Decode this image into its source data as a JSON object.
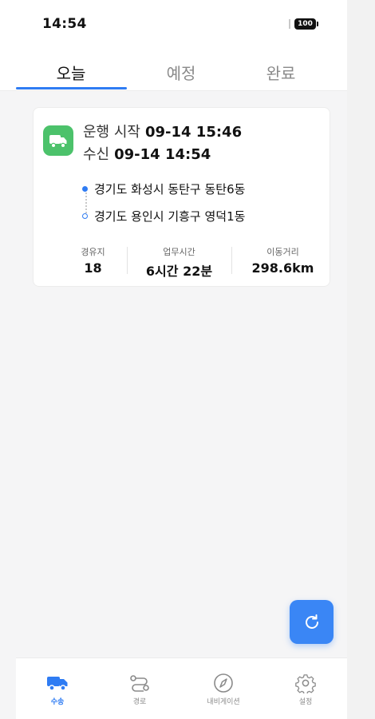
{
  "status_bar": {
    "time": "14:54",
    "battery": "100"
  },
  "tabs": [
    {
      "label": "오늘",
      "active": true
    },
    {
      "label": "예정",
      "active": false
    },
    {
      "label": "완료",
      "active": false
    }
  ],
  "card": {
    "start_label": "운행 시작",
    "start_time": "09-14 15:46",
    "received_label": "수신",
    "received_time": "09-14 14:54",
    "origin": "경기도 화성시 동탄구 동탄6동",
    "destination": "경기도 용인시 기흥구 영덕1동",
    "stats": [
      {
        "label": "경유지",
        "value": "18"
      },
      {
        "label": "업무시간",
        "value": "6시간  22분"
      },
      {
        "label": "이동거리",
        "value": "298.6km"
      }
    ],
    "badge_color": "#4cc26b"
  },
  "accent_color": "#2f7cf3",
  "bottom_nav": [
    {
      "label": "수송",
      "icon": "truck-icon",
      "active": true
    },
    {
      "label": "경로",
      "icon": "route-icon",
      "active": false
    },
    {
      "label": "내비게이션",
      "icon": "compass-icon",
      "active": false
    },
    {
      "label": "설정",
      "icon": "gear-icon",
      "active": false
    }
  ]
}
